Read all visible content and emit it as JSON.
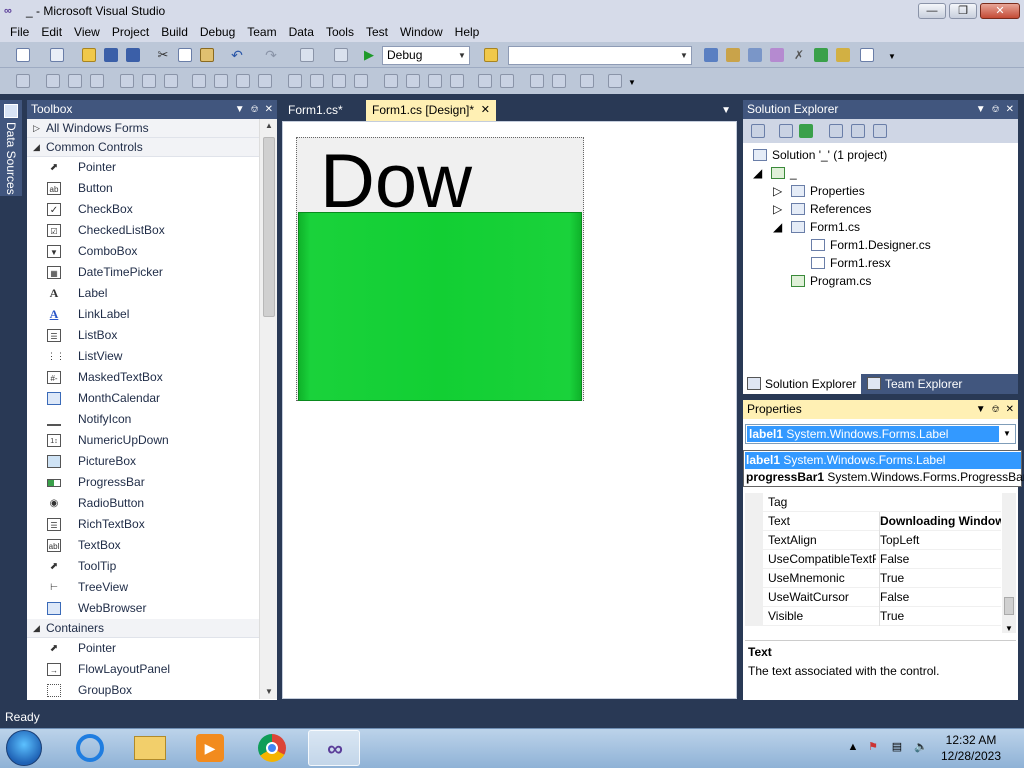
{
  "window": {
    "title": "_ - Microsoft Visual Studio",
    "logo_text": "∞"
  },
  "menu": [
    "File",
    "Edit",
    "View",
    "Project",
    "Build",
    "Debug",
    "Team",
    "Data",
    "Tools",
    "Test",
    "Window",
    "Help"
  ],
  "toolbar": {
    "config_value": "Debug",
    "platform_value": ""
  },
  "sidetab": {
    "label": "Data Sources"
  },
  "toolbox": {
    "title": "Toolbox",
    "categories": [
      {
        "label": "All Windows Forms",
        "expanded": false
      },
      {
        "label": "Common Controls",
        "expanded": true
      },
      {
        "label": "Containers",
        "expanded": true
      }
    ],
    "common_controls": [
      "Pointer",
      "Button",
      "CheckBox",
      "CheckedListBox",
      "ComboBox",
      "DateTimePicker",
      "Label",
      "LinkLabel",
      "ListBox",
      "ListView",
      "MaskedTextBox",
      "MonthCalendar",
      "NotifyIcon",
      "NumericUpDown",
      "PictureBox",
      "ProgressBar",
      "RadioButton",
      "RichTextBox",
      "TextBox",
      "ToolTip",
      "TreeView",
      "WebBrowser"
    ],
    "containers": [
      "Pointer",
      "FlowLayoutPanel",
      "GroupBox"
    ]
  },
  "editor": {
    "tabs": [
      "Form1.cs*",
      "Form1.cs [Design]*"
    ],
    "label_text": "Dow"
  },
  "solution_explorer": {
    "title": "Solution Explorer",
    "tree": [
      "Solution '_' (1 project)",
      "_",
      "Properties",
      "References",
      "Form1.cs",
      "Form1.Designer.cs",
      "Form1.resx",
      "Program.cs"
    ],
    "bottom_tabs": [
      "Solution Explorer",
      "Team Explorer"
    ]
  },
  "properties": {
    "title": "Properties",
    "selected_object": {
      "name": "label1",
      "type": "System.Windows.Forms.Label"
    },
    "dropdown_items": [
      {
        "name": "label1",
        "type": "System.Windows.Forms.Label"
      },
      {
        "name": "progressBar1",
        "type": "System.Windows.Forms.ProgressBar"
      }
    ],
    "rows": [
      {
        "name": "Tag",
        "value": "",
        "bold": false
      },
      {
        "name": "Text",
        "value": "Downloading Window",
        "bold": true
      },
      {
        "name": "TextAlign",
        "value": "TopLeft",
        "bold": false
      },
      {
        "name": "UseCompatibleTextRendering",
        "value": "False",
        "bold": false
      },
      {
        "name": "UseMnemonic",
        "value": "True",
        "bold": false
      },
      {
        "name": "UseWaitCursor",
        "value": "False",
        "bold": false
      },
      {
        "name": "Visible",
        "value": "True",
        "bold": false
      }
    ],
    "desc_title": "Text",
    "desc_text": "The text associated with the control."
  },
  "status": {
    "text": "Ready"
  },
  "taskbar": {
    "time": "12:32 AM",
    "date": "12/28/2023"
  },
  "colors": {
    "chrome": "#293955",
    "panel_header": "#41567e",
    "active_tab": "#fff0b4",
    "progress": "#12cf33",
    "selection": "#3399ff"
  }
}
